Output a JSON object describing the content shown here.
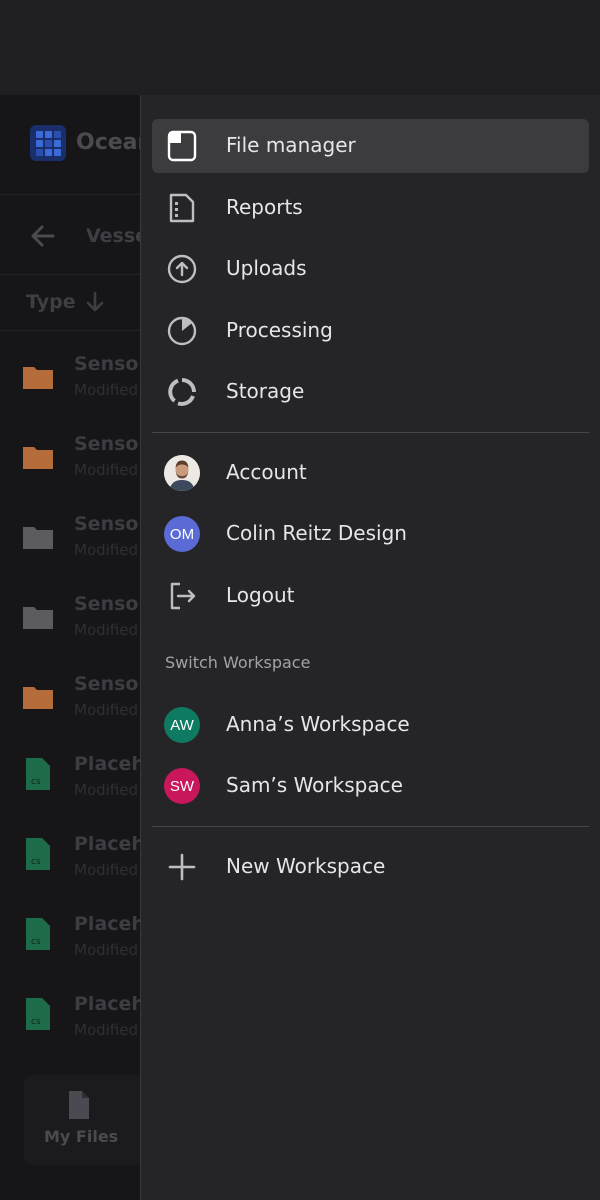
{
  "background_app": {
    "app_name": "Ocear",
    "breadcrumb": "Vesse",
    "sort_label": "Type",
    "rows": [
      {
        "name": "Sensor",
        "meta": "Modified",
        "kind": "folder",
        "color": "#b66b3a"
      },
      {
        "name": "Sensor",
        "meta": "Modified",
        "kind": "folder",
        "color": "#b66b3a"
      },
      {
        "name": "Sensor",
        "meta": "Modified",
        "kind": "folder",
        "color": "#5c5c60"
      },
      {
        "name": "Sensor",
        "meta": "Modified",
        "kind": "folder",
        "color": "#5c5c60"
      },
      {
        "name": "Sensor",
        "meta": "Modified",
        "kind": "folder",
        "color": "#b66b3a"
      },
      {
        "name": "Placeh",
        "meta": "Modified",
        "kind": "csv",
        "color": "#1e6b4a"
      },
      {
        "name": "Placeh",
        "meta": "Modified",
        "kind": "csv",
        "color": "#1e6b4a"
      },
      {
        "name": "Placeh",
        "meta": "Modified",
        "kind": "csv",
        "color": "#1e6b4a"
      },
      {
        "name": "Placeh",
        "meta": "Modified",
        "kind": "csv",
        "color": "#1e6b4a"
      }
    ],
    "tab_label": "My Files"
  },
  "drawer": {
    "menu": [
      {
        "label": "File manager",
        "icon": "file-icon",
        "active": true
      },
      {
        "label": "Reports",
        "icon": "report-icon"
      },
      {
        "label": "Uploads",
        "icon": "upload-icon"
      },
      {
        "label": "Processing",
        "icon": "pie-chart-icon"
      },
      {
        "label": "Storage",
        "icon": "storage-ring-icon"
      }
    ],
    "account": [
      {
        "label": "Account",
        "avatar": "photo"
      },
      {
        "label": "Colin Reitz Design",
        "initials": "OM",
        "color": "#5b6bd6"
      },
      {
        "label": "Logout",
        "icon": "logout-icon"
      }
    ],
    "switch_title": "Switch Workspace",
    "workspaces": [
      {
        "label": "Anna’s Workspace",
        "initials": "AW",
        "color": "#0e7a62"
      },
      {
        "label": "Sam’s Workspace",
        "initials": "SW",
        "color": "#c8175a"
      }
    ],
    "new_workspace": {
      "label": "New Workspace",
      "icon": "plus-icon"
    }
  }
}
